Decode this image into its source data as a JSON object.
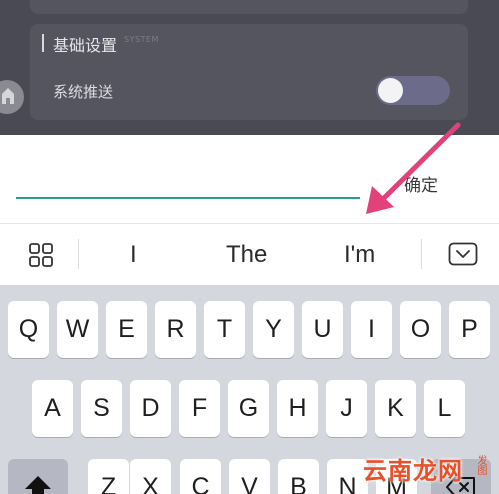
{
  "settings": {
    "section_title": "基础设置",
    "section_subtitle": "SYSTEM",
    "push_label": "系统推送",
    "push_enabled": false
  },
  "dialog": {
    "input_value": "",
    "confirm_label": "确定"
  },
  "suggestions": {
    "items": [
      "I",
      "The",
      "I'm"
    ],
    "grid_icon": "apps-grid-icon",
    "hide_icon": "keyboard-hide-icon"
  },
  "keyboard": {
    "row1": [
      "Q",
      "W",
      "E",
      "R",
      "T",
      "Y",
      "U",
      "I",
      "O",
      "P"
    ],
    "row2": [
      "A",
      "S",
      "D",
      "F",
      "G",
      "H",
      "J",
      "K",
      "L"
    ],
    "row3": [
      "Z",
      "X",
      "C",
      "V",
      "B",
      "N",
      "M"
    ],
    "shift_icon": "shift-icon",
    "backspace_icon": "backspace-icon"
  },
  "watermark": {
    "text": "云南龙网",
    "side_text": "发图"
  },
  "colors": {
    "accent_underline": "#2a9d8f",
    "annotation_arrow": "#e2417a",
    "watermark": "#e8502a"
  }
}
